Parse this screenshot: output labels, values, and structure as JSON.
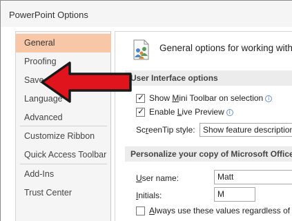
{
  "window": {
    "title": "PowerPoint Options"
  },
  "sidebar": {
    "items": [
      {
        "label": "General"
      },
      {
        "label": "Proofing"
      },
      {
        "label": "Save"
      },
      {
        "label": "Language"
      },
      {
        "label": "Advanced"
      },
      {
        "label": "Customize Ribbon"
      },
      {
        "label": "Quick Access Toolbar"
      },
      {
        "label": "Add-Ins"
      },
      {
        "label": "Trust Center"
      }
    ],
    "active_item": "General"
  },
  "main": {
    "header": "General options for working with",
    "ui_options": {
      "title": "User Interface options",
      "mini_toolbar": {
        "pre": "Show ",
        "u": "M",
        "post": "ini Toolbar on selection",
        "checked": true
      },
      "live_preview": {
        "pre": "Enable ",
        "u": "L",
        "post": "ive Preview",
        "checked": true
      },
      "screentip": {
        "pre": "Sc",
        "u": "r",
        "post": "eenTip style:",
        "value": "Show feature descriptions"
      }
    },
    "personalize": {
      "title": "Personalize your copy of Microsoft Office",
      "username": {
        "u": "U",
        "post": "ser name:",
        "value": "Matt"
      },
      "initials": {
        "u": "I",
        "post": "nitials:",
        "value": "M"
      },
      "always_use": {
        "u": "A",
        "post": "lways use these values regardless of sig",
        "checked": false
      }
    }
  },
  "annotation": {
    "color": "#e0141c",
    "outline": "#1a1a1a"
  }
}
